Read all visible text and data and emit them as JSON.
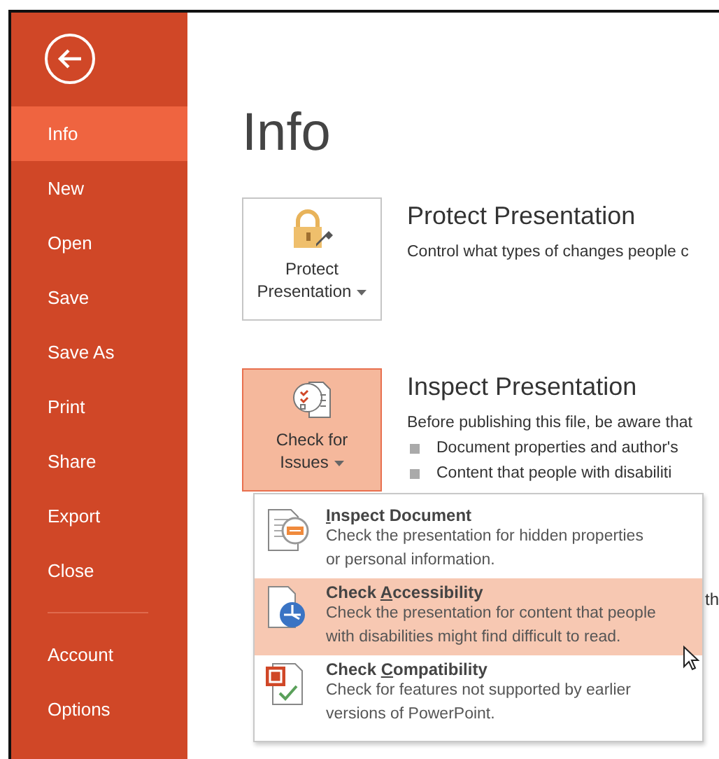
{
  "sidebar": {
    "items": [
      {
        "label": "Info",
        "selected": true
      },
      {
        "label": "New",
        "selected": false
      },
      {
        "label": "Open",
        "selected": false
      },
      {
        "label": "Save",
        "selected": false
      },
      {
        "label": "Save As",
        "selected": false
      },
      {
        "label": "Print",
        "selected": false
      },
      {
        "label": "Share",
        "selected": false
      },
      {
        "label": "Export",
        "selected": false
      },
      {
        "label": "Close",
        "selected": false
      }
    ],
    "bottom_items": [
      {
        "label": "Account",
        "selected": false
      },
      {
        "label": "Options",
        "selected": false
      }
    ]
  },
  "page_title": "Info",
  "sections": [
    {
      "kind": "protect",
      "button_label": [
        "Protect",
        "Presentation"
      ],
      "pressed": false,
      "title": "Protect Presentation",
      "description": "Control what types of changes people c"
    },
    {
      "kind": "inspect",
      "button_label": [
        "Check for",
        "Issues"
      ],
      "pressed": true,
      "title": "Inspect Presentation",
      "description": "Before publishing this file, be aware that",
      "bullets": [
        "Document properties and author's",
        "Content that people with disabiliti"
      ]
    }
  ],
  "peek_text": "th",
  "menu": {
    "items": [
      {
        "kind": "inspect",
        "access_key": "I",
        "title_after": "nspect Document",
        "description": "Check the presentation for hidden properties or personal information.",
        "selected": false
      },
      {
        "kind": "accessibility",
        "title_before": "Check ",
        "access_key": "A",
        "title_after": "ccessibility",
        "description": "Check the presentation for content that people with disabilities might find difficult to read.",
        "selected": true
      },
      {
        "kind": "compatibility",
        "title_before": "Check ",
        "access_key": "C",
        "title_after": "ompatibility",
        "description": "Check for features not supported by earlier versions of PowerPoint.",
        "selected": false
      }
    ]
  }
}
